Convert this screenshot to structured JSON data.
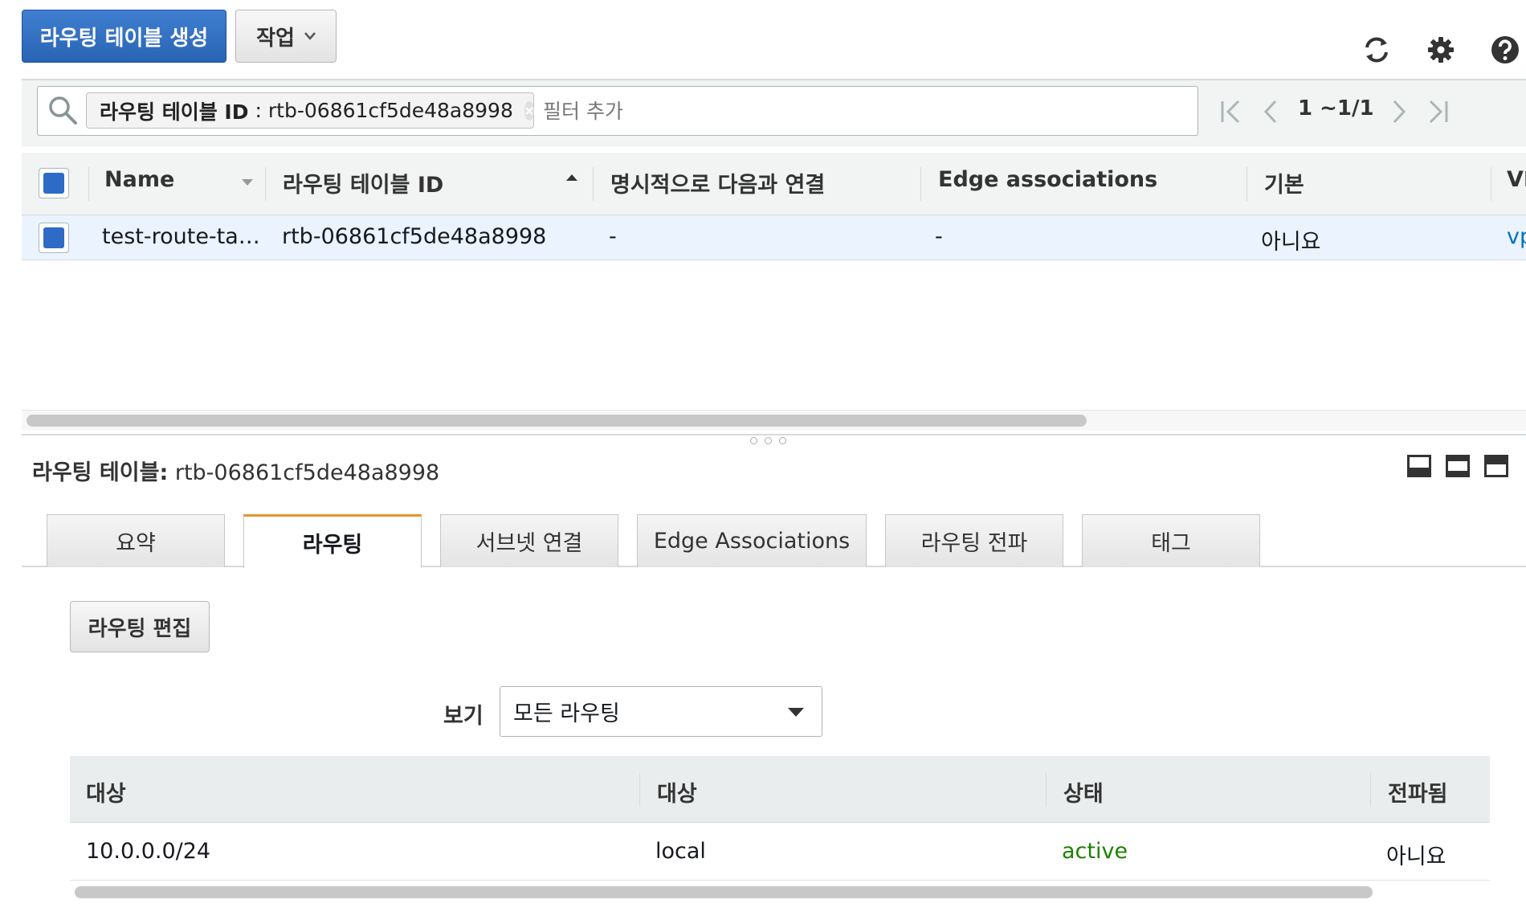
{
  "toolbar": {
    "create_label": "라우팅 테이블 생성",
    "actions_label": "작업",
    "refresh_icon": "refresh-icon",
    "settings_icon": "gear-icon",
    "help_icon": "help-icon"
  },
  "filter": {
    "token_key": "라우팅 테이블 ID",
    "token_sep": ":",
    "token_value": "rtb-06861cf5de48a8998",
    "placeholder": "필터 추가"
  },
  "pagination": {
    "text": "1 ~1/1"
  },
  "grid": {
    "columns": [
      "Name",
      "라우팅 테이블 ID",
      "명시적으로 다음과 연결",
      "Edge associations",
      "기본",
      "VP"
    ],
    "rows": [
      {
        "name": "test-route-ta…",
        "id": "rtb-06861cf5de48a8998",
        "explicit": "-",
        "edge": "-",
        "main": "아니요",
        "vpc": "vp"
      }
    ]
  },
  "details": {
    "title_label": "라우팅 테이블:",
    "title_value": "rtb-06861cf5de48a8998",
    "tabs": [
      "요약",
      "라우팅",
      "서브넷 연결",
      "Edge Associations",
      "라우팅 전파",
      "태그"
    ],
    "active_tab": "라우팅",
    "edit_label": "라우팅 편집",
    "view_label": "보기",
    "view_selected": "모든 라우팅"
  },
  "routes": {
    "columns": [
      "대상",
      "대상",
      "상태",
      "전파됨"
    ],
    "rows": [
      {
        "destination": "10.0.0.0/24",
        "target": "local",
        "status": "active",
        "propagated": "아니요"
      }
    ]
  },
  "colors": {
    "primary": "#2a64b4",
    "active_tab": "#e8912d",
    "selected_row": "#eaf3fe",
    "status_active": "#1d8102",
    "link": "#0073bb"
  }
}
